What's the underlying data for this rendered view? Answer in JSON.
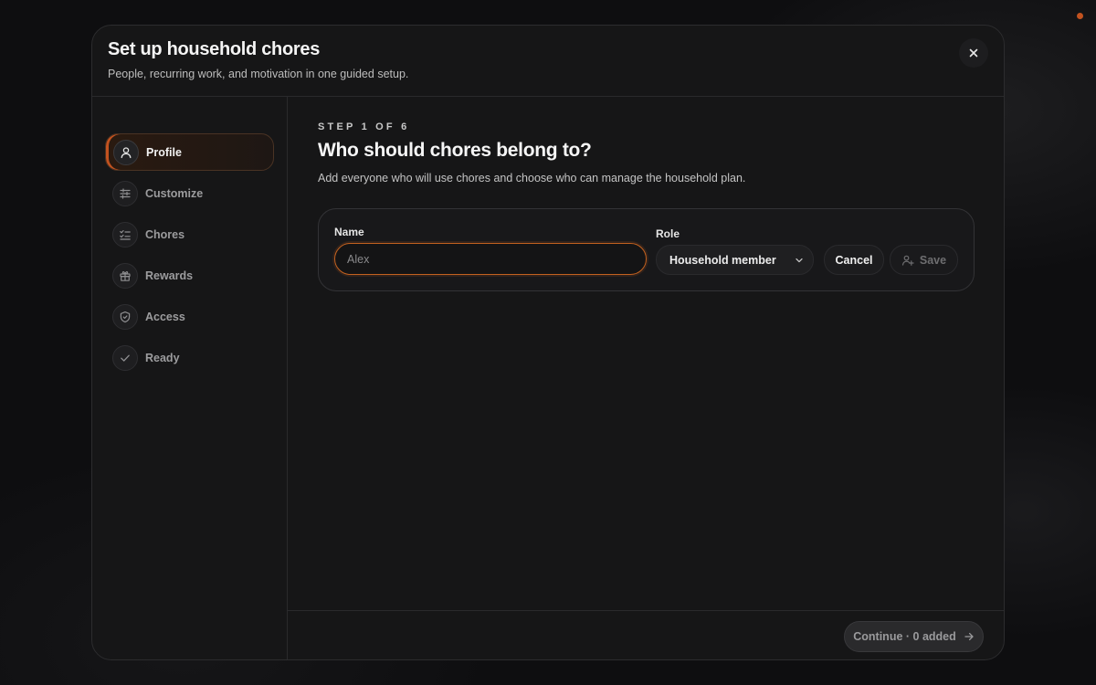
{
  "dialog": {
    "title": "Set up household chores",
    "subtitle": "People, recurring work, and motivation in one guided setup."
  },
  "steps": [
    {
      "label": "Profile",
      "icon": "user-icon",
      "active": true
    },
    {
      "label": "Customize",
      "icon": "sliders-icon",
      "active": false
    },
    {
      "label": "Chores",
      "icon": "checklist-icon",
      "active": false
    },
    {
      "label": "Rewards",
      "icon": "gift-icon",
      "active": false
    },
    {
      "label": "Access",
      "icon": "shield-icon",
      "active": false
    },
    {
      "label": "Ready",
      "icon": "check-icon",
      "active": false
    }
  ],
  "main": {
    "eyebrow": "STEP 1 OF 6",
    "title": "Who should chores belong to?",
    "description": "Add everyone who will use chores and choose who can manage the household plan."
  },
  "form": {
    "name_label": "Name",
    "name_placeholder": "Alex",
    "name_value": "",
    "role_label": "Role",
    "role_value": "Household member",
    "cancel_label": "Cancel",
    "save_label": "Save"
  },
  "footer": {
    "continue_label": "Continue · 0 added"
  },
  "colors": {
    "accent": "#c2521f",
    "modal_bg": "#161617",
    "page_bg": "#0e0e10"
  }
}
